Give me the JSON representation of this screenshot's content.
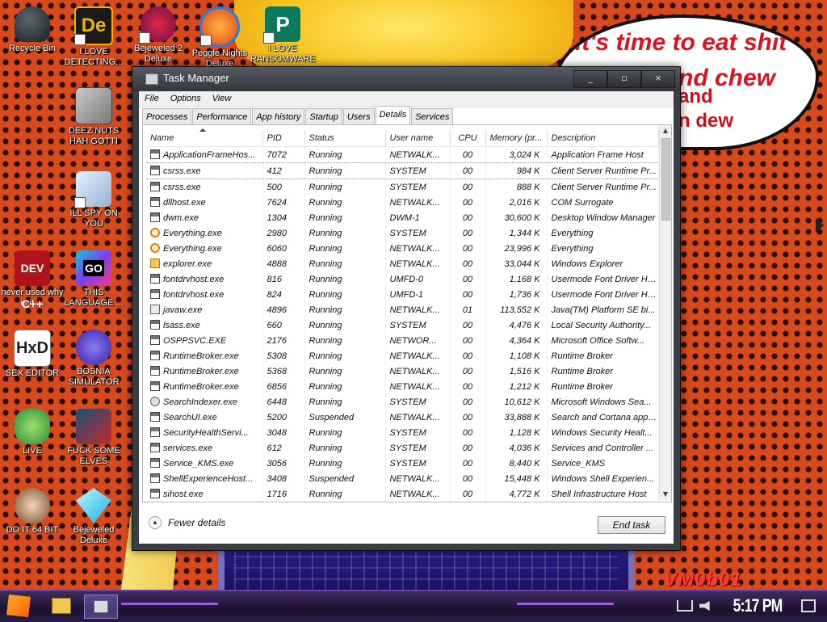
{
  "desktop": {
    "speech_bubble": [
      "it's time to eat shit",
      "nd chew",
      "and",
      "n dew"
    ],
    "watermark": "VM0b01",
    "icons": [
      {
        "label": "Recycle Bin",
        "icon": "recycle-bin-icon"
      },
      {
        "label": "I LOVE DETECTING...",
        "icon": "detect-it-easy-icon"
      },
      {
        "label": "Bejeweled 2 Deluxe",
        "icon": "bejeweled2-icon"
      },
      {
        "label": "Peggle Nights Deluxe",
        "icon": "peggle-icon"
      },
      {
        "label": "I LOVE RANSOMWARE",
        "icon": "publisher-icon"
      },
      {
        "label": "DEEZ NUTS HAH GOTTI",
        "icon": "copy-icon"
      },
      {
        "label": "ILL SPY ON YOU",
        "icon": "spy-icon"
      },
      {
        "label": "never used why is it ...",
        "icon": "devcpp-icon"
      },
      {
        "label": "THIS LANGUAGE ...",
        "icon": "goland-icon"
      },
      {
        "label": "SEX EDITOR",
        "icon": "hxd-icon"
      },
      {
        "label": "BOSNIA SIMULATOR",
        "icon": "mine-icon"
      },
      {
        "label": "LIVE",
        "icon": "peridot-icon"
      },
      {
        "label": "FUCK SOME ELVES",
        "icon": "santa-icon"
      },
      {
        "label": "DO IT 64 BIT",
        "icon": "portrait-icon"
      },
      {
        "label": "Bejeweled Deluxe",
        "icon": "diamond-icon"
      }
    ]
  },
  "window": {
    "title": "Task Manager",
    "controls": [
      "_",
      "▫",
      "×"
    ],
    "menu": [
      "File",
      "Options",
      "View"
    ],
    "tabs": [
      "Processes",
      "Performance",
      "App history",
      "Startup",
      "Users",
      "Details",
      "Services"
    ],
    "active_tab": "Details",
    "columns": [
      "Name",
      "PID",
      "Status",
      "User name",
      "CPU",
      "Memory (pr...",
      "Description"
    ],
    "rows": [
      {
        "icon": "window",
        "name": "ApplicationFrameHos...",
        "pid": "7072",
        "status": "Running",
        "user": "NETWALK...",
        "cpu": "00",
        "mem": "3,024 K",
        "desc": "Application Frame Host"
      },
      {
        "icon": "window",
        "name": "csrss.exe",
        "pid": "412",
        "status": "Running",
        "user": "SYSTEM",
        "cpu": "00",
        "mem": "984 K",
        "desc": "Client Server Runtime Pr...",
        "selected": true
      },
      {
        "icon": "window",
        "name": "csrss.exe",
        "pid": "500",
        "status": "Running",
        "user": "SYSTEM",
        "cpu": "00",
        "mem": "888 K",
        "desc": "Client Server Runtime Pr..."
      },
      {
        "icon": "window",
        "name": "dllhost.exe",
        "pid": "7624",
        "status": "Running",
        "user": "NETWALK...",
        "cpu": "00",
        "mem": "2,016 K",
        "desc": "COM Surrogate"
      },
      {
        "icon": "window",
        "name": "dwm.exe",
        "pid": "1304",
        "status": "Running",
        "user": "DWM-1",
        "cpu": "00",
        "mem": "30,600 K",
        "desc": "Desktop Window Manager"
      },
      {
        "icon": "search",
        "name": "Everything.exe",
        "pid": "2980",
        "status": "Running",
        "user": "SYSTEM",
        "cpu": "00",
        "mem": "1,344 K",
        "desc": "Everything"
      },
      {
        "icon": "search",
        "name": "Everything.exe",
        "pid": "6060",
        "status": "Running",
        "user": "NETWALK...",
        "cpu": "00",
        "mem": "23,996 K",
        "desc": "Everything"
      },
      {
        "icon": "folder",
        "name": "explorer.exe",
        "pid": "4888",
        "status": "Running",
        "user": "NETWALK...",
        "cpu": "00",
        "mem": "33,044 K",
        "desc": "Windows Explorer"
      },
      {
        "icon": "window",
        "name": "fontdrvhost.exe",
        "pid": "816",
        "status": "Running",
        "user": "UMFD-0",
        "cpu": "00",
        "mem": "1,168 K",
        "desc": "Usermode Font Driver Host"
      },
      {
        "icon": "window",
        "name": "fontdrvhost.exe",
        "pid": "824",
        "status": "Running",
        "user": "UMFD-1",
        "cpu": "00",
        "mem": "1,736 K",
        "desc": "Usermode Font Driver Host"
      },
      {
        "icon": "java",
        "name": "javaw.exe",
        "pid": "4896",
        "status": "Running",
        "user": "NETWALK...",
        "cpu": "01",
        "mem": "113,552 K",
        "desc": "Java(TM) Platform SE bi..."
      },
      {
        "icon": "window",
        "name": "lsass.exe",
        "pid": "660",
        "status": "Running",
        "user": "SYSTEM",
        "cpu": "00",
        "mem": "4,476 K",
        "desc": "Local Security Authority..."
      },
      {
        "icon": "window",
        "name": "OSPPSVC.EXE",
        "pid": "2176",
        "status": "Running",
        "user": "NETWOR...",
        "cpu": "00",
        "mem": "4,364 K",
        "desc": "Microsoft Office Softw..."
      },
      {
        "icon": "window",
        "name": "RuntimeBroker.exe",
        "pid": "5308",
        "status": "Running",
        "user": "NETWALK...",
        "cpu": "00",
        "mem": "1,108 K",
        "desc": "Runtime Broker"
      },
      {
        "icon": "window",
        "name": "RuntimeBroker.exe",
        "pid": "5368",
        "status": "Running",
        "user": "NETWALK...",
        "cpu": "00",
        "mem": "1,516 K",
        "desc": "Runtime Broker"
      },
      {
        "icon": "window",
        "name": "RuntimeBroker.exe",
        "pid": "6856",
        "status": "Running",
        "user": "NETWALK...",
        "cpu": "00",
        "mem": "1,212 K",
        "desc": "Runtime Broker"
      },
      {
        "icon": "indexer",
        "name": "SearchIndexer.exe",
        "pid": "6448",
        "status": "Running",
        "user": "SYSTEM",
        "cpu": "00",
        "mem": "10,612 K",
        "desc": "Microsoft Windows Sea..."
      },
      {
        "icon": "window",
        "name": "SearchUI.exe",
        "pid": "5200",
        "status": "Suspended",
        "user": "NETWALK...",
        "cpu": "00",
        "mem": "33,888 K",
        "desc": "Search and Cortana appli..."
      },
      {
        "icon": "window",
        "name": "SecurityHealthServi...",
        "pid": "3048",
        "status": "Running",
        "user": "SYSTEM",
        "cpu": "00",
        "mem": "1,128 K",
        "desc": "Windows Security Healt..."
      },
      {
        "icon": "window",
        "name": "services.exe",
        "pid": "612",
        "status": "Running",
        "user": "SYSTEM",
        "cpu": "00",
        "mem": "4,036 K",
        "desc": "Services and Controller ..."
      },
      {
        "icon": "window",
        "name": "Service_KMS.exe",
        "pid": "3056",
        "status": "Running",
        "user": "SYSTEM",
        "cpu": "00",
        "mem": "8,440 K",
        "desc": "Service_KMS"
      },
      {
        "icon": "window",
        "name": "ShellExperienceHost...",
        "pid": "3408",
        "status": "Suspended",
        "user": "NETWALK...",
        "cpu": "00",
        "mem": "15,448 K",
        "desc": "Windows Shell Experien..."
      },
      {
        "icon": "window",
        "name": "sihost.exe",
        "pid": "1716",
        "status": "Running",
        "user": "NETWALK...",
        "cpu": "00",
        "mem": "4,772 K",
        "desc": "Shell Infrastructure Host"
      }
    ],
    "fewer_details": "Fewer details",
    "end_task": "End task"
  },
  "taskbar": {
    "clock": "5:17 PM"
  }
}
